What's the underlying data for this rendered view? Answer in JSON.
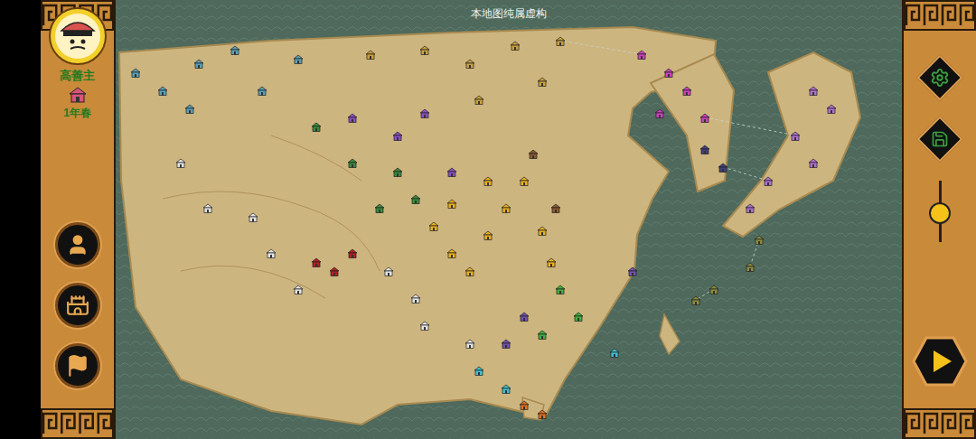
{
  "map": {
    "notice": "本地图纯属虚构"
  },
  "player": {
    "name": "高善主",
    "date": "1年春"
  },
  "zoom_slider": {
    "level": 0.45
  },
  "cities": [
    {
      "color": "#5aa0b8"
    },
    {
      "color": "#5aa0b8"
    },
    {
      "color": "#5aa0b8"
    },
    {
      "color": "#5aa0b8"
    },
    {
      "color": "#5aa0b8"
    },
    {
      "color": "#5aa0b8"
    },
    {
      "color": "#5aa0b8"
    },
    {
      "color": "#c9a040"
    },
    {
      "color": "#c9a040"
    },
    {
      "color": "#c9a040"
    },
    {
      "color": "#c9a040"
    },
    {
      "color": "#c9a040"
    },
    {
      "color": "#c9a040"
    },
    {
      "color": "#c9a040"
    },
    {
      "color": "#8a4fc0"
    },
    {
      "color": "#8a4fc0"
    },
    {
      "color": "#8a4fc0"
    },
    {
      "color": "#8a4fc0"
    },
    {
      "color": "#3a8a3a"
    },
    {
      "color": "#3a8a3a"
    },
    {
      "color": "#3a8a3a"
    },
    {
      "color": "#3a8a3a"
    },
    {
      "color": "#3a8a3a"
    },
    {
      "color": "#e4e4e4"
    },
    {
      "color": "#e4e4e4"
    },
    {
      "color": "#e4e4e4"
    },
    {
      "color": "#e4e4e4"
    },
    {
      "color": "#e4e4e4"
    },
    {
      "color": "#e4e4e4"
    },
    {
      "color": "#e4e4e4"
    },
    {
      "color": "#e4e4e4"
    },
    {
      "color": "#e4e4e4"
    },
    {
      "color": "#b02020"
    },
    {
      "color": "#b02020"
    },
    {
      "color": "#b02020"
    },
    {
      "color": "#e8b020"
    },
    {
      "color": "#e8b020"
    },
    {
      "color": "#e8b020"
    },
    {
      "color": "#e8b020"
    },
    {
      "color": "#e8b020"
    },
    {
      "color": "#e8b020"
    },
    {
      "color": "#e8b020"
    },
    {
      "color": "#e8b020"
    },
    {
      "color": "#e8b020"
    },
    {
      "color": "#e8b020"
    },
    {
      "color": "#d040c0"
    },
    {
      "color": "#d040c0"
    },
    {
      "color": "#d040c0"
    },
    {
      "color": "#d040c0"
    },
    {
      "color": "#d040c0"
    },
    {
      "color": "#b070d0"
    },
    {
      "color": "#b070d0"
    },
    {
      "color": "#b070d0"
    },
    {
      "color": "#b070d0"
    },
    {
      "color": "#b070d0"
    },
    {
      "color": "#b070d0"
    },
    {
      "color": "#404080"
    },
    {
      "color": "#404080"
    },
    {
      "color": "#40b040"
    },
    {
      "color": "#40b040"
    },
    {
      "color": "#40b040"
    },
    {
      "color": "#40c0d0"
    },
    {
      "color": "#40c0d0"
    },
    {
      "color": "#40c0d0"
    },
    {
      "color": "#e07020"
    },
    {
      "color": "#e07020"
    },
    {
      "color": "#7050b0"
    },
    {
      "color": "#7050b0"
    },
    {
      "color": "#7050b0"
    },
    {
      "color": "#8a5a30"
    },
    {
      "color": "#8a5a30"
    },
    {
      "color": "#8a8a40"
    },
    {
      "color": "#8a8a40"
    },
    {
      "color": "#8a8a40"
    },
    {
      "color": "#8a8a40"
    }
  ]
}
